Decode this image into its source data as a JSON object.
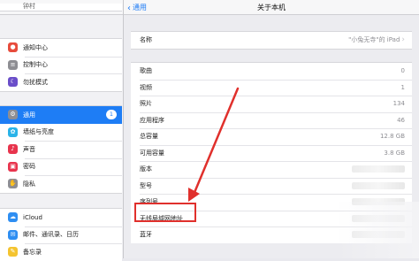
{
  "left": {
    "title": "设置",
    "top_partial_label": "钟村",
    "group1": [
      {
        "label": "通知中心",
        "icon": "notification-icon",
        "color": "#e74c3c"
      },
      {
        "label": "控制中心",
        "icon": "control-center-icon",
        "color": "#8e8e93"
      },
      {
        "label": "勿扰模式",
        "icon": "moon-icon",
        "color": "#6a4ec9"
      }
    ],
    "group2": [
      {
        "label": "通用",
        "icon": "gear-icon",
        "color": "#8e8e93",
        "badge": "1"
      },
      {
        "label": "墙纸与亮度",
        "icon": "flower-icon",
        "color": "#2ab3e8"
      },
      {
        "label": "声音",
        "icon": "speaker-icon",
        "color": "#e8344d"
      },
      {
        "label": "密码",
        "icon": "lock-icon",
        "color": "#e8344d"
      },
      {
        "label": "隐私",
        "icon": "hand-icon",
        "color": "#8e8e93"
      }
    ],
    "group3": [
      {
        "label": "iCloud",
        "icon": "cloud-icon",
        "color": "#2e8ef2"
      },
      {
        "label": "邮件、通讯录、日历",
        "icon": "mail-icon",
        "color": "#2e8ef2"
      },
      {
        "label": "备忘录",
        "icon": "notes-icon",
        "color": "#f4c430"
      }
    ]
  },
  "right": {
    "back_label": "通用",
    "title": "关于本机",
    "name_row": {
      "label": "名称",
      "value": "\"小兔无寺\"的 iPad"
    },
    "rows": [
      {
        "label": "歌曲",
        "value": "0"
      },
      {
        "label": "视频",
        "value": "1"
      },
      {
        "label": "照片",
        "value": "134"
      },
      {
        "label": "应用程序",
        "value": "46"
      },
      {
        "label": "总容量",
        "value": "12.8 GB"
      },
      {
        "label": "可用容量",
        "value": "3.8 GB"
      },
      {
        "label": "版本",
        "value": ""
      },
      {
        "label": "型号",
        "value": ""
      },
      {
        "label": "序列号",
        "value": ""
      },
      {
        "label": "无线局域网地址",
        "value": ""
      },
      {
        "label": "蓝牙",
        "value": ""
      }
    ]
  },
  "colors": {
    "accent": "#1e7df5",
    "annotation": "#e0302c"
  }
}
